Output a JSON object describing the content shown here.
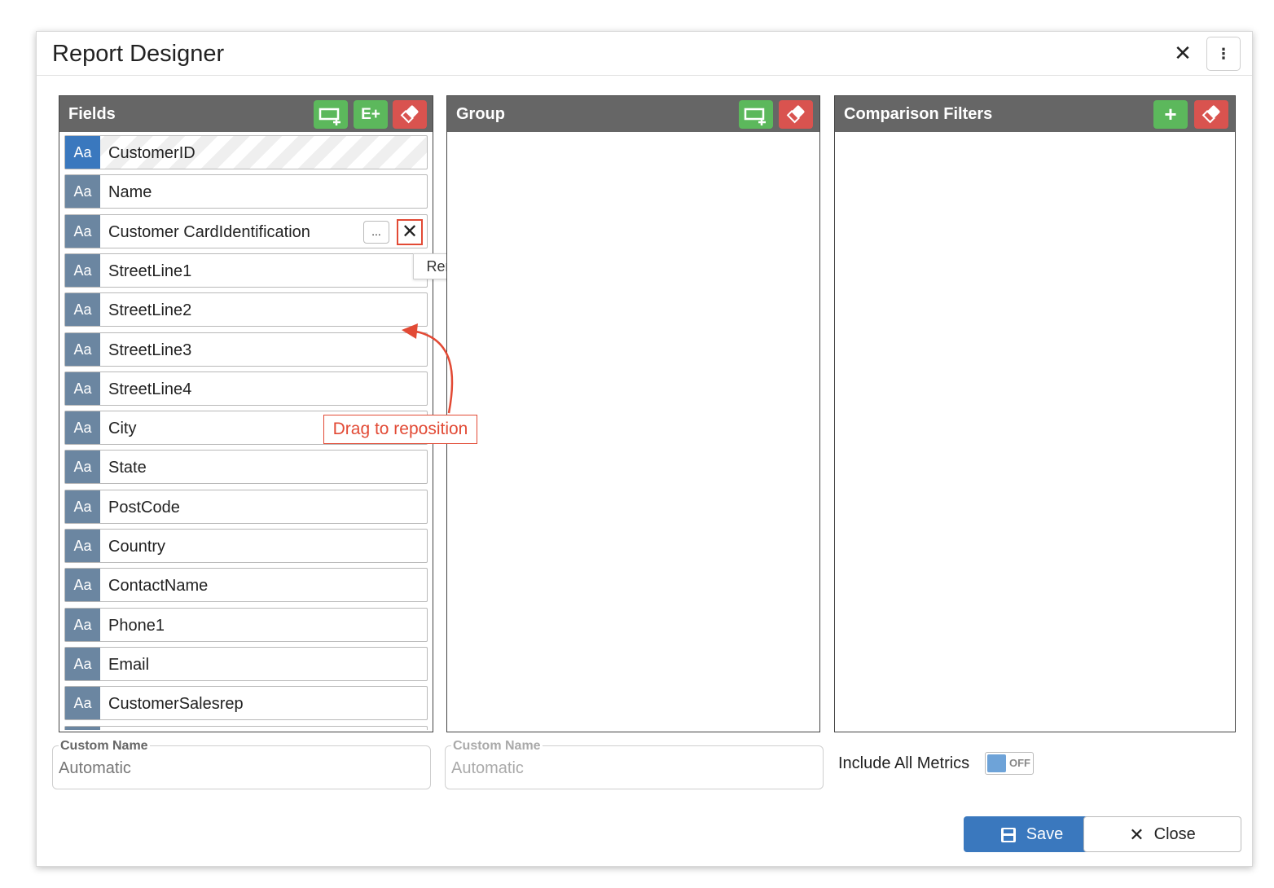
{
  "dialog": {
    "title": "Report Designer",
    "close_glyph": "✕",
    "menu_glyph": "⋮"
  },
  "fields_panel": {
    "title": "Fields",
    "buttons": [
      {
        "icon": "add-field-icon",
        "color": "#5cb85c"
      },
      {
        "icon": "add-expression-icon",
        "label": "E+",
        "color": "#5cb85c"
      },
      {
        "icon": "eraser-icon",
        "color": "#d9534f"
      }
    ],
    "items": [
      {
        "type": "Aa",
        "name": "CustomerID",
        "selected": true
      },
      {
        "type": "Aa",
        "name": "Name"
      },
      {
        "type": "Aa",
        "name": "Customer CardIdentification",
        "hovered": true
      },
      {
        "type": "Aa",
        "name": "StreetLine1"
      },
      {
        "type": "Aa",
        "name": "StreetLine2"
      },
      {
        "type": "Aa",
        "name": "StreetLine3"
      },
      {
        "type": "Aa",
        "name": "StreetLine4"
      },
      {
        "type": "Aa",
        "name": "City"
      },
      {
        "type": "Aa",
        "name": "State"
      },
      {
        "type": "Aa",
        "name": "PostCode"
      },
      {
        "type": "Aa",
        "name": "Country"
      },
      {
        "type": "Aa",
        "name": "ContactName"
      },
      {
        "type": "Aa",
        "name": "Phone1"
      },
      {
        "type": "Aa",
        "name": "Email"
      },
      {
        "type": "Aa",
        "name": "CustomerSalesrep"
      }
    ],
    "more_label": "...",
    "remove_glyph": "✕",
    "tooltip": "Remove the field"
  },
  "group_panel": {
    "title": "Group",
    "buttons": [
      {
        "icon": "add-group-icon",
        "color": "#5cb85c"
      },
      {
        "icon": "eraser-icon",
        "color": "#d9534f"
      }
    ]
  },
  "filters_panel": {
    "title": "Comparison Filters",
    "buttons": [
      {
        "icon": "plus-icon",
        "label": "+",
        "color": "#5cb85c"
      },
      {
        "icon": "eraser-icon",
        "color": "#d9534f"
      }
    ]
  },
  "annotation": {
    "drag_label": "Drag  to reposition",
    "color": "#e24a35"
  },
  "fields_custom_name": {
    "legend": "Custom Name",
    "value": "Automatic"
  },
  "group_custom_name": {
    "legend": "Custom Name",
    "value": "Automatic"
  },
  "metrics": {
    "label": "Include All Metrics",
    "toggle_state": "OFF"
  },
  "footer": {
    "save_label": "Save",
    "close_label": "Close",
    "close_glyph": "✕"
  }
}
